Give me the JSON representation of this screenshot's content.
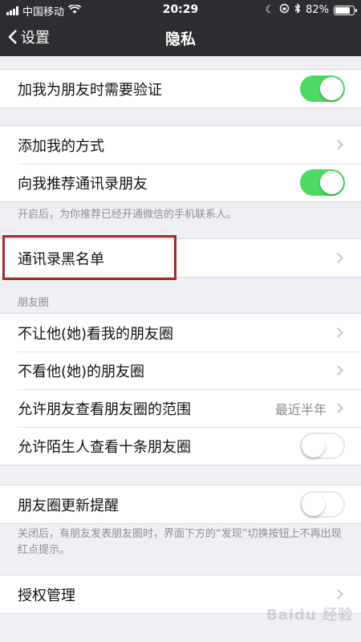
{
  "status_bar": {
    "carrier": "中国移动",
    "time": "20:29",
    "battery": "82%",
    "battery_fraction": 0.82
  },
  "nav": {
    "back_label": "设置",
    "title": "隐私"
  },
  "group1": {
    "items": [
      {
        "label": "加我为朋友时需要验证",
        "toggle": "on"
      }
    ]
  },
  "group2": {
    "items": [
      {
        "label": "添加我的方式"
      },
      {
        "label": "向我推荐通讯录朋友",
        "toggle": "on"
      }
    ],
    "note": "开启后，为你推荐已经开通微信的手机联系人。"
  },
  "group3": {
    "items": [
      {
        "label": "通讯录黑名单"
      }
    ]
  },
  "moments": {
    "header": "朋友圈",
    "items": [
      {
        "label": "不让他(她)看我的朋友圈"
      },
      {
        "label": "不看他(她)的朋友圈"
      },
      {
        "label": "允许朋友查看朋友圈的范围",
        "value": "最近半年"
      },
      {
        "label": "允许陌生人查看十条朋友圈",
        "toggle": "off"
      }
    ]
  },
  "group5": {
    "items": [
      {
        "label": "朋友圈更新提醒",
        "toggle": "off"
      }
    ],
    "note": "关闭后，有朋友发表朋友圈时，界面下方的“发现”切换按钮上不再出现红点提示。"
  },
  "group6": {
    "items": [
      {
        "label": "授权管理"
      }
    ]
  },
  "watermark": "Baidu 经验",
  "colors": {
    "toggle_on": "#4cd964",
    "highlight": "#a52a2a",
    "nav_bg": "#2e2e32"
  }
}
